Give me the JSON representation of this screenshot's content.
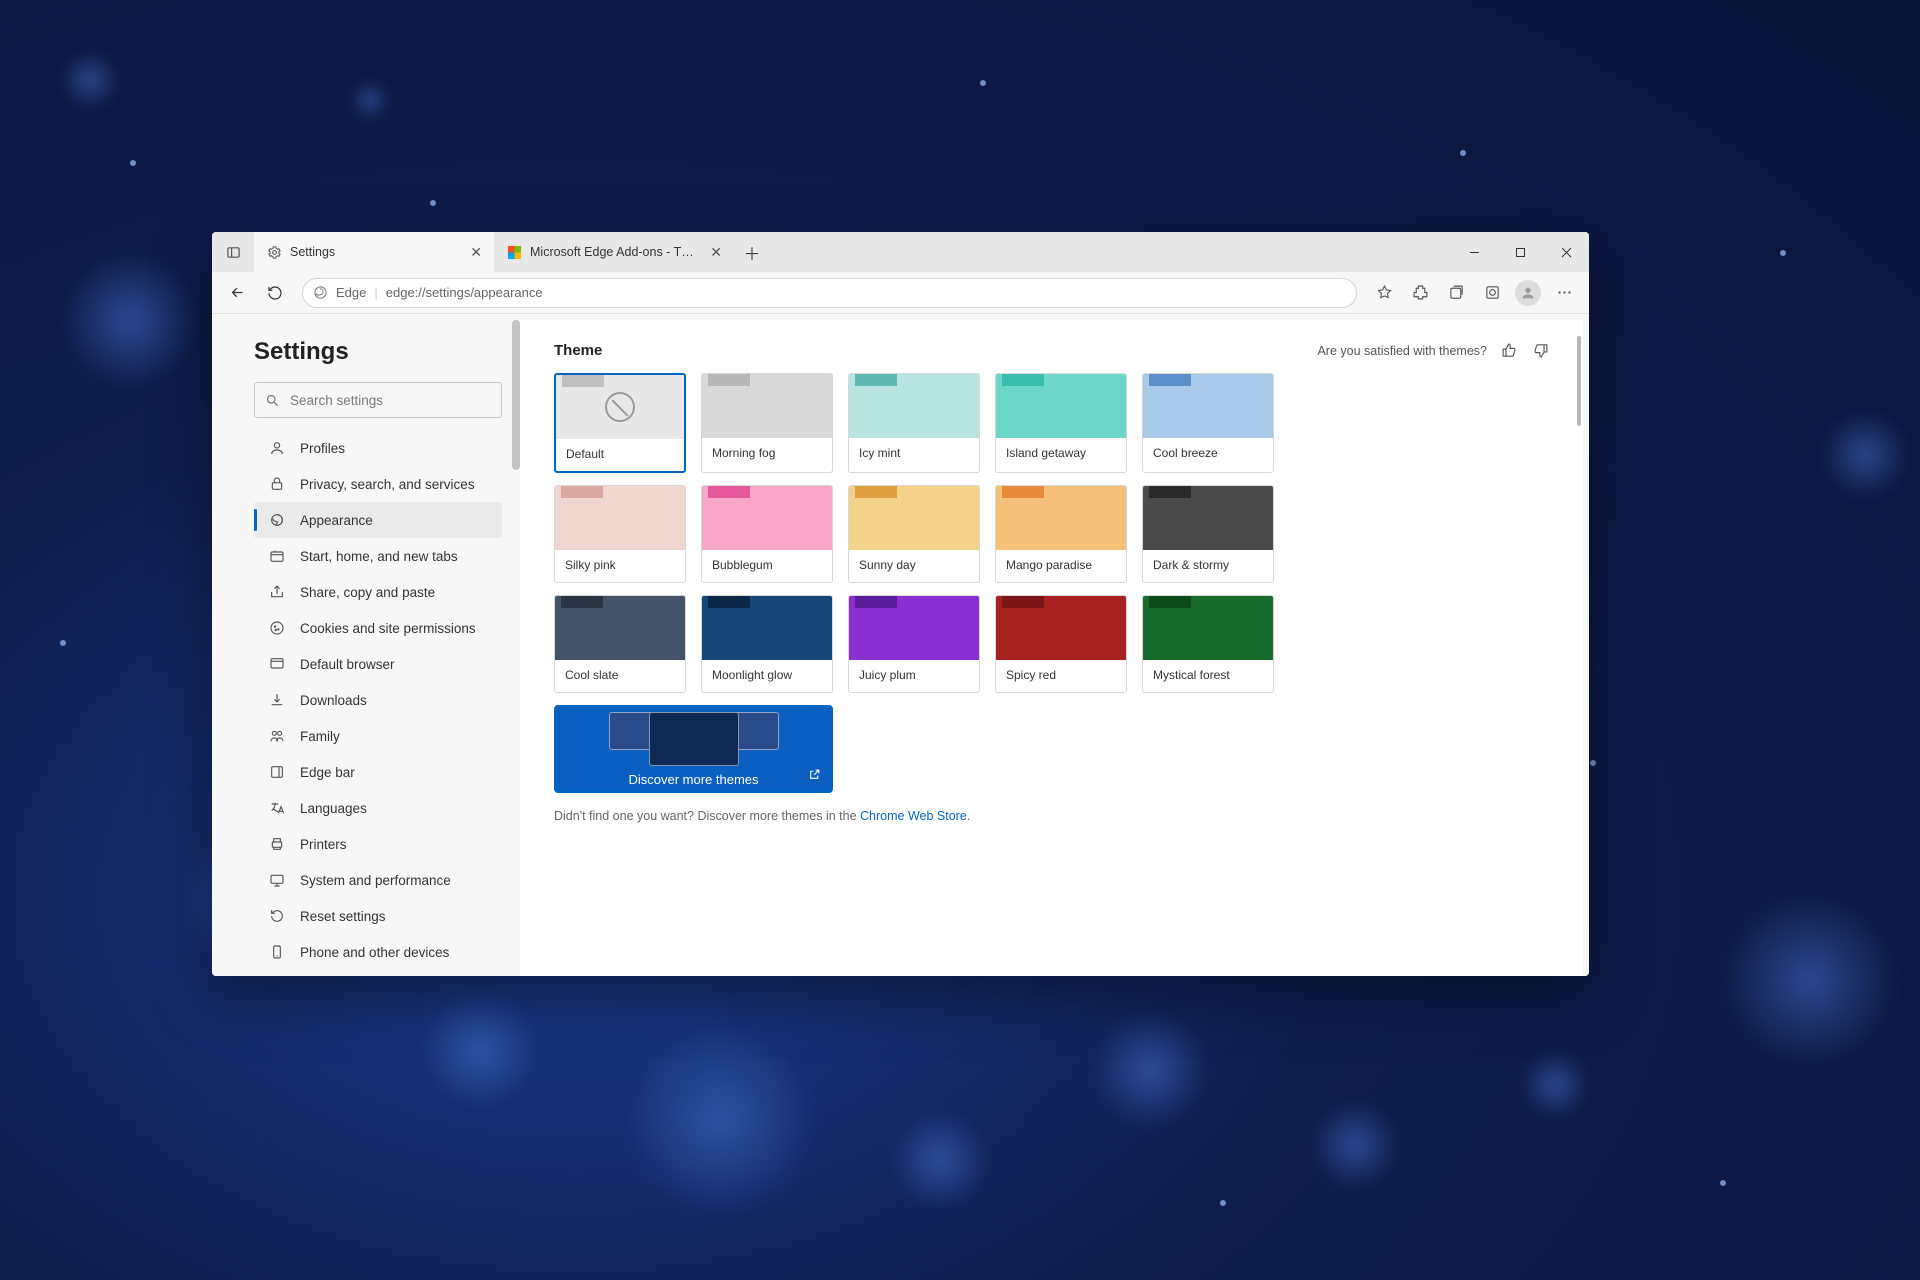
{
  "titlebar": {
    "tabs": [
      {
        "title": "Settings",
        "icon": "gear"
      },
      {
        "title": "Microsoft Edge Add-ons - Them…",
        "icon": "edge-color"
      }
    ]
  },
  "toolbar": {
    "address_prefix_icon_label": "Edge",
    "address": "edge://settings/appearance"
  },
  "sidebar": {
    "title": "Settings",
    "search_placeholder": "Search settings",
    "items": [
      {
        "label": "Profiles",
        "icon": "user"
      },
      {
        "label": "Privacy, search, and services",
        "icon": "lock"
      },
      {
        "label": "Appearance",
        "icon": "paint",
        "active": true
      },
      {
        "label": "Start, home, and new tabs",
        "icon": "tabs"
      },
      {
        "label": "Share, copy and paste",
        "icon": "share"
      },
      {
        "label": "Cookies and site permissions",
        "icon": "cookie"
      },
      {
        "label": "Default browser",
        "icon": "browser"
      },
      {
        "label": "Downloads",
        "icon": "download"
      },
      {
        "label": "Family",
        "icon": "family"
      },
      {
        "label": "Edge bar",
        "icon": "edgebar"
      },
      {
        "label": "Languages",
        "icon": "lang"
      },
      {
        "label": "Printers",
        "icon": "printer"
      },
      {
        "label": "System and performance",
        "icon": "system"
      },
      {
        "label": "Reset settings",
        "icon": "reset"
      },
      {
        "label": "Phone and other devices",
        "icon": "phone"
      }
    ]
  },
  "main": {
    "theme_heading": "Theme",
    "feedback_prompt": "Are you satisfied with themes?",
    "themes": [
      {
        "label": "Default",
        "tab": "#bfbfbf",
        "body": "#e8e8e8",
        "selected": true,
        "default": true
      },
      {
        "label": "Morning fog",
        "tab": "#b8b8b8",
        "body": "#d9d9d9"
      },
      {
        "label": "Icy mint",
        "tab": "#5fb9b0",
        "body": "#b9e4df"
      },
      {
        "label": "Island getaway",
        "tab": "#38bfae",
        "body": "#6cd6c8"
      },
      {
        "label": "Cool breeze",
        "tab": "#5a8fc7",
        "body": "#a9c9e8"
      },
      {
        "label": "Silky pink",
        "tab": "#d9a8a0",
        "body": "#f0d6d0"
      },
      {
        "label": "Bubblegum",
        "tab": "#e65a9c",
        "body": "#f7a8c9"
      },
      {
        "label": "Sunny day",
        "tab": "#e0a040",
        "body": "#f3d38a"
      },
      {
        "label": "Mango paradise",
        "tab": "#e88a3a",
        "body": "#f5c07a"
      },
      {
        "label": "Dark & stormy",
        "tab": "#2a2a2a",
        "body": "#4a4a4a"
      },
      {
        "label": "Cool slate",
        "tab": "#2a3442",
        "body": "#44526a"
      },
      {
        "label": "Moonlight glow",
        "tab": "#0d2847",
        "body": "#16457a"
      },
      {
        "label": "Juicy plum",
        "tab": "#5a1d9c",
        "body": "#8a2fd1"
      },
      {
        "label": "Spicy red",
        "tab": "#7a1616",
        "body": "#a82020"
      },
      {
        "label": "Mystical forest",
        "tab": "#0d4a1c",
        "body": "#166b2a"
      }
    ],
    "discover_label": "Discover more themes",
    "footnote_text": "Didn't find one you want? Discover more themes in the ",
    "footnote_link": "Chrome Web Store",
    "footnote_period": "."
  }
}
